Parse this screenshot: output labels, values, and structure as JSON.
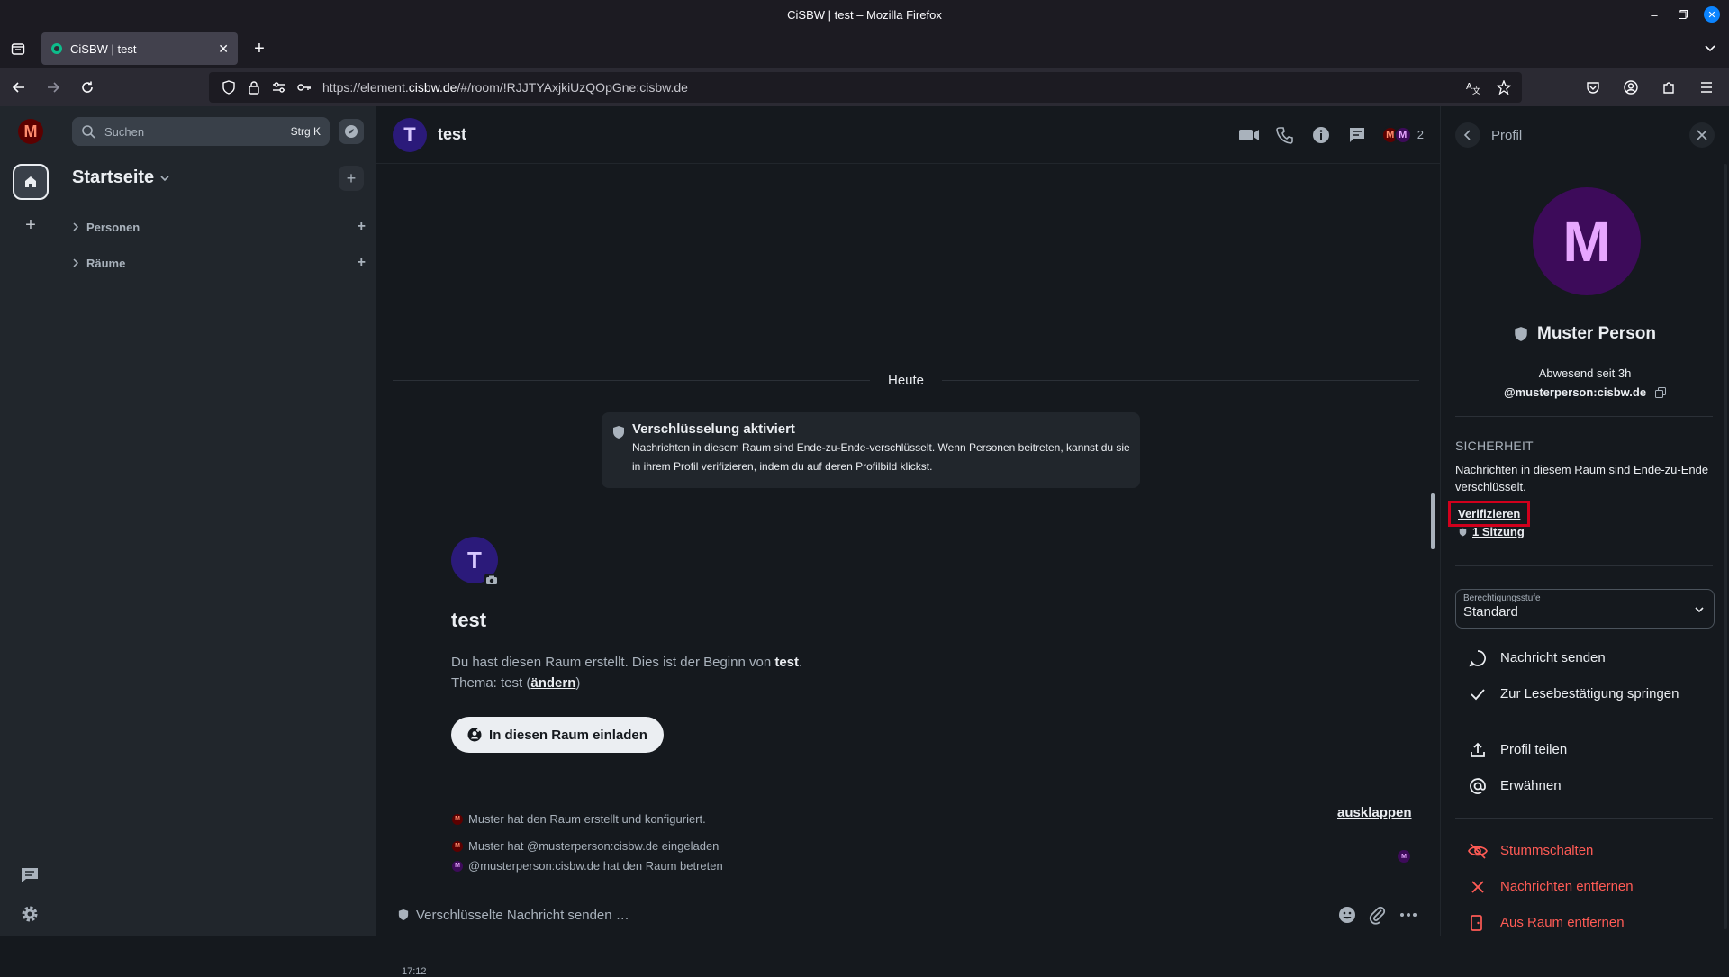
{
  "window": {
    "title": "CiSBW | test – Mozilla Firefox",
    "tab_title": "CiSBW | test",
    "url_prefix": "https://element.",
    "url_domain": "cisbw.de",
    "url_rest": "/#/room/!RJJTYAxjkiUzQOpGne:cisbw.de"
  },
  "spaces": {
    "user_initial": "M"
  },
  "roomlist": {
    "search_placeholder": "Suchen",
    "search_shortcut": "Strg K",
    "home_title": "Startseite",
    "sections": [
      {
        "label": "Personen"
      },
      {
        "label": "Räume"
      }
    ]
  },
  "room": {
    "initial": "T",
    "name": "test",
    "member_initials": [
      "M",
      "M"
    ],
    "member_count": "2",
    "date_separator": "Heute",
    "encryption": {
      "title": "Verschlüsselung aktiviert",
      "description": "Nachrichten in diesem Raum sind Ende-zu-Ende-verschlüsselt. Wenn Personen beitreten, kannst du sie in ihrem Profil verifizieren, indem du auf deren Profilbild klickst."
    },
    "intro": {
      "title": "test",
      "desc_prefix": "Du hast diesen Raum erstellt. Dies ist der Beginn von ",
      "desc_room": "test",
      "desc_suffix": ".",
      "topic_prefix": "Thema: test (",
      "topic_link": "ändern",
      "topic_suffix": ")",
      "invite_label": "In diesen Raum einladen"
    },
    "events": [
      {
        "text": "Muster hat den Raum erstellt und konfiguriert.",
        "avatar": "M"
      },
      {
        "text": "Muster hat @musterperson:cisbw.de eingeladen",
        "avatar": "M"
      },
      {
        "text": "@musterperson:cisbw.de hat den Raum betreten",
        "avatar": "M"
      }
    ],
    "event_time": "17:12",
    "expand_label": "ausklappen",
    "receipt_initial": "M",
    "composer_placeholder": "Verschlüsselte Nachricht senden …"
  },
  "profile": {
    "panel_title": "Profil",
    "initial": "M",
    "display_name": "Muster Person",
    "presence": "Abwesend seit 3h",
    "user_id": "@musterperson:cisbw.de",
    "security_title": "SICHERHEIT",
    "security_desc": "Nachrichten in diesem Raum sind Ende-zu-Ende verschlüsselt.",
    "verify_label": "Verifizieren",
    "sessions_label": "1 Sitzung",
    "power_label": "Berechtigungsstufe",
    "power_value": "Standard",
    "actions": {
      "send_message": "Nachricht senden",
      "jump_receipt": "Zur Lesebestätigung springen",
      "share": "Profil teilen",
      "mention": "Erwähnen",
      "mute": "Stummschalten",
      "remove_messages": "Nachrichten entfernen",
      "kick": "Aus Raum entfernen"
    },
    "danger_color": "#ff5b55"
  }
}
